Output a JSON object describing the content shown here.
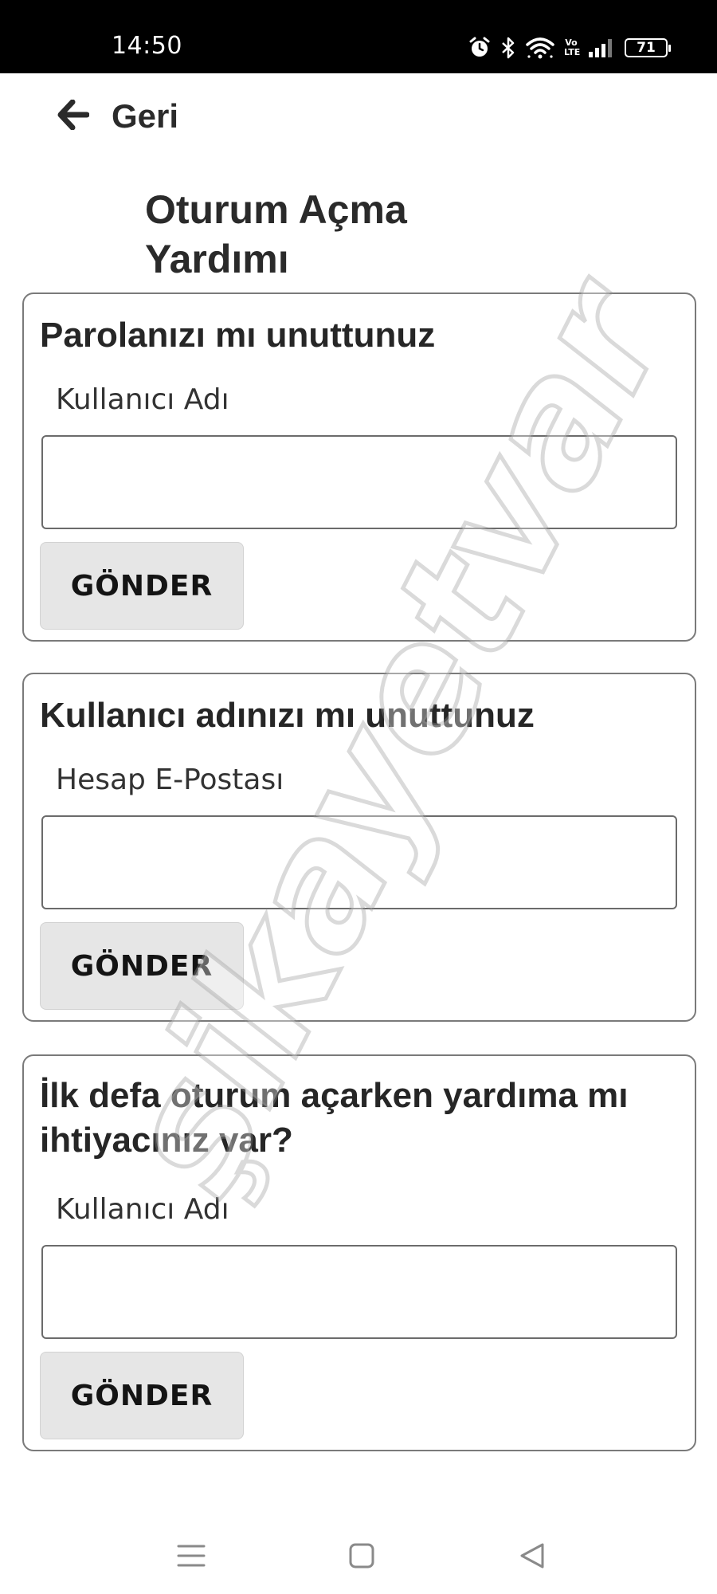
{
  "status_bar": {
    "time": "14:50",
    "battery": "71",
    "icons": [
      "alarm-icon",
      "bluetooth-icon",
      "wifi-icon",
      "volte-icon",
      "signal-icon",
      "battery-icon"
    ],
    "volte_text": "Vo LTE"
  },
  "header": {
    "back_label": "Geri",
    "back_icon": "arrow-left-icon",
    "title": "Oturum Açma Yardımı"
  },
  "sections": [
    {
      "title": "Parolanızı mı unuttunuz",
      "field_label": "Kullanıcı Adı",
      "field_value": "",
      "button_label": "GÖNDER"
    },
    {
      "title": "Kullanıcı adınızı mı unuttunuz",
      "field_label": "Hesap E-Postası",
      "field_value": "",
      "button_label": "GÖNDER"
    },
    {
      "title": "İlk defa oturum açarken yardıma mı ihtiyacınız var?",
      "field_label": "Kullanıcı Adı",
      "field_value": "",
      "button_label": "GÖNDER"
    }
  ],
  "watermark": "şikayetvar",
  "nav_bar": {
    "icons": [
      "menu-icon",
      "home-square-icon",
      "back-triangle-icon"
    ]
  },
  "colors": {
    "status_bar_bg": "#000000",
    "card_border": "#7a7a7a",
    "button_bg": "#e6e6e6",
    "text": "#262626"
  }
}
